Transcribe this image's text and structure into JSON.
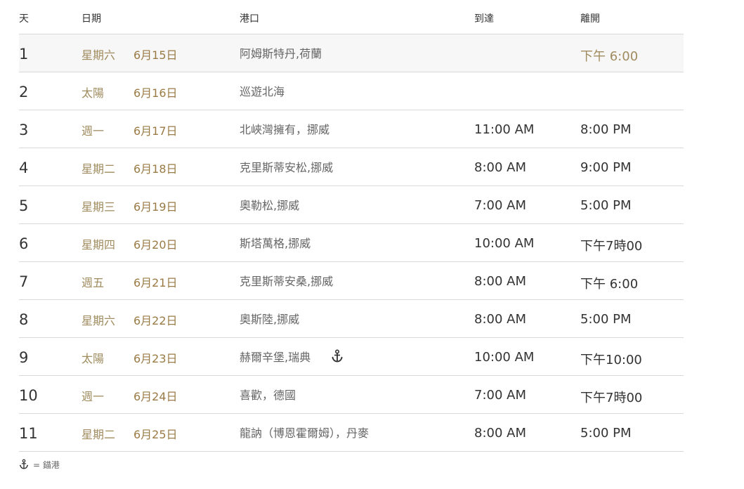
{
  "header": {
    "day": "天",
    "date": "日期",
    "port": "港口",
    "arrive": "到達",
    "depart": "離開"
  },
  "rows": [
    {
      "day": "1",
      "weekday": "星期六",
      "date": "6月15日",
      "port": "阿姆斯特丹,荷蘭",
      "arrive": "",
      "depart": "下午 6:00",
      "highlight": true
    },
    {
      "day": "2",
      "weekday": "太陽",
      "date": "6月16日",
      "port": "巡遊北海",
      "arrive": "",
      "depart": ""
    },
    {
      "day": "3",
      "weekday": "週一",
      "date": "6月17日",
      "port": "北峽灣擁有，挪威",
      "arrive": "11:00 AM",
      "depart": "8:00 PM"
    },
    {
      "day": "4",
      "weekday": "星期二",
      "date": "6月18日",
      "port": "克里斯蒂安松,挪威",
      "arrive": "8:00 AM",
      "depart": "9:00 PM"
    },
    {
      "day": "5",
      "weekday": "星期三",
      "date": "6月19日",
      "port": "奧勒松,挪威",
      "arrive": "7:00 AM",
      "depart": "5:00 PM"
    },
    {
      "day": "6",
      "weekday": "星期四",
      "date": "6月20日",
      "port": "斯塔萬格,挪威",
      "arrive": "10:00 AM",
      "depart": "下午7時00"
    },
    {
      "day": "7",
      "weekday": "週五",
      "date": "6月21日",
      "port": "克里斯蒂安桑,挪威",
      "arrive": "8:00 AM",
      "depart": "下午 6:00"
    },
    {
      "day": "8",
      "weekday": "星期六",
      "date": "6月22日",
      "port": "奧斯陸,挪威",
      "arrive": "8:00 AM",
      "depart": "5:00 PM"
    },
    {
      "day": "9",
      "weekday": "太陽",
      "date": "6月23日",
      "port": "赫爾辛堡,瑞典",
      "arrive": "10:00 AM",
      "depart": "下午10:00",
      "anchor": true
    },
    {
      "day": "10",
      "weekday": "週一",
      "date": "6月24日",
      "port": "喜歡，德國",
      "arrive": "7:00 AM",
      "depart": "下午7時00"
    },
    {
      "day": "11",
      "weekday": "星期二",
      "date": "6月25日",
      "port": "龍訥（博恩霍爾姆），丹麥",
      "arrive": "8:00 AM",
      "depart": "5:00 PM"
    }
  ],
  "legend": {
    "icon": "anchor-icon",
    "text": "= 錨港"
  },
  "colors": {
    "gold": "#a08c5f",
    "date_gold": "#9a7b45",
    "divider": "#d9d9d9",
    "highlight_bg": "#f7f7f7"
  }
}
